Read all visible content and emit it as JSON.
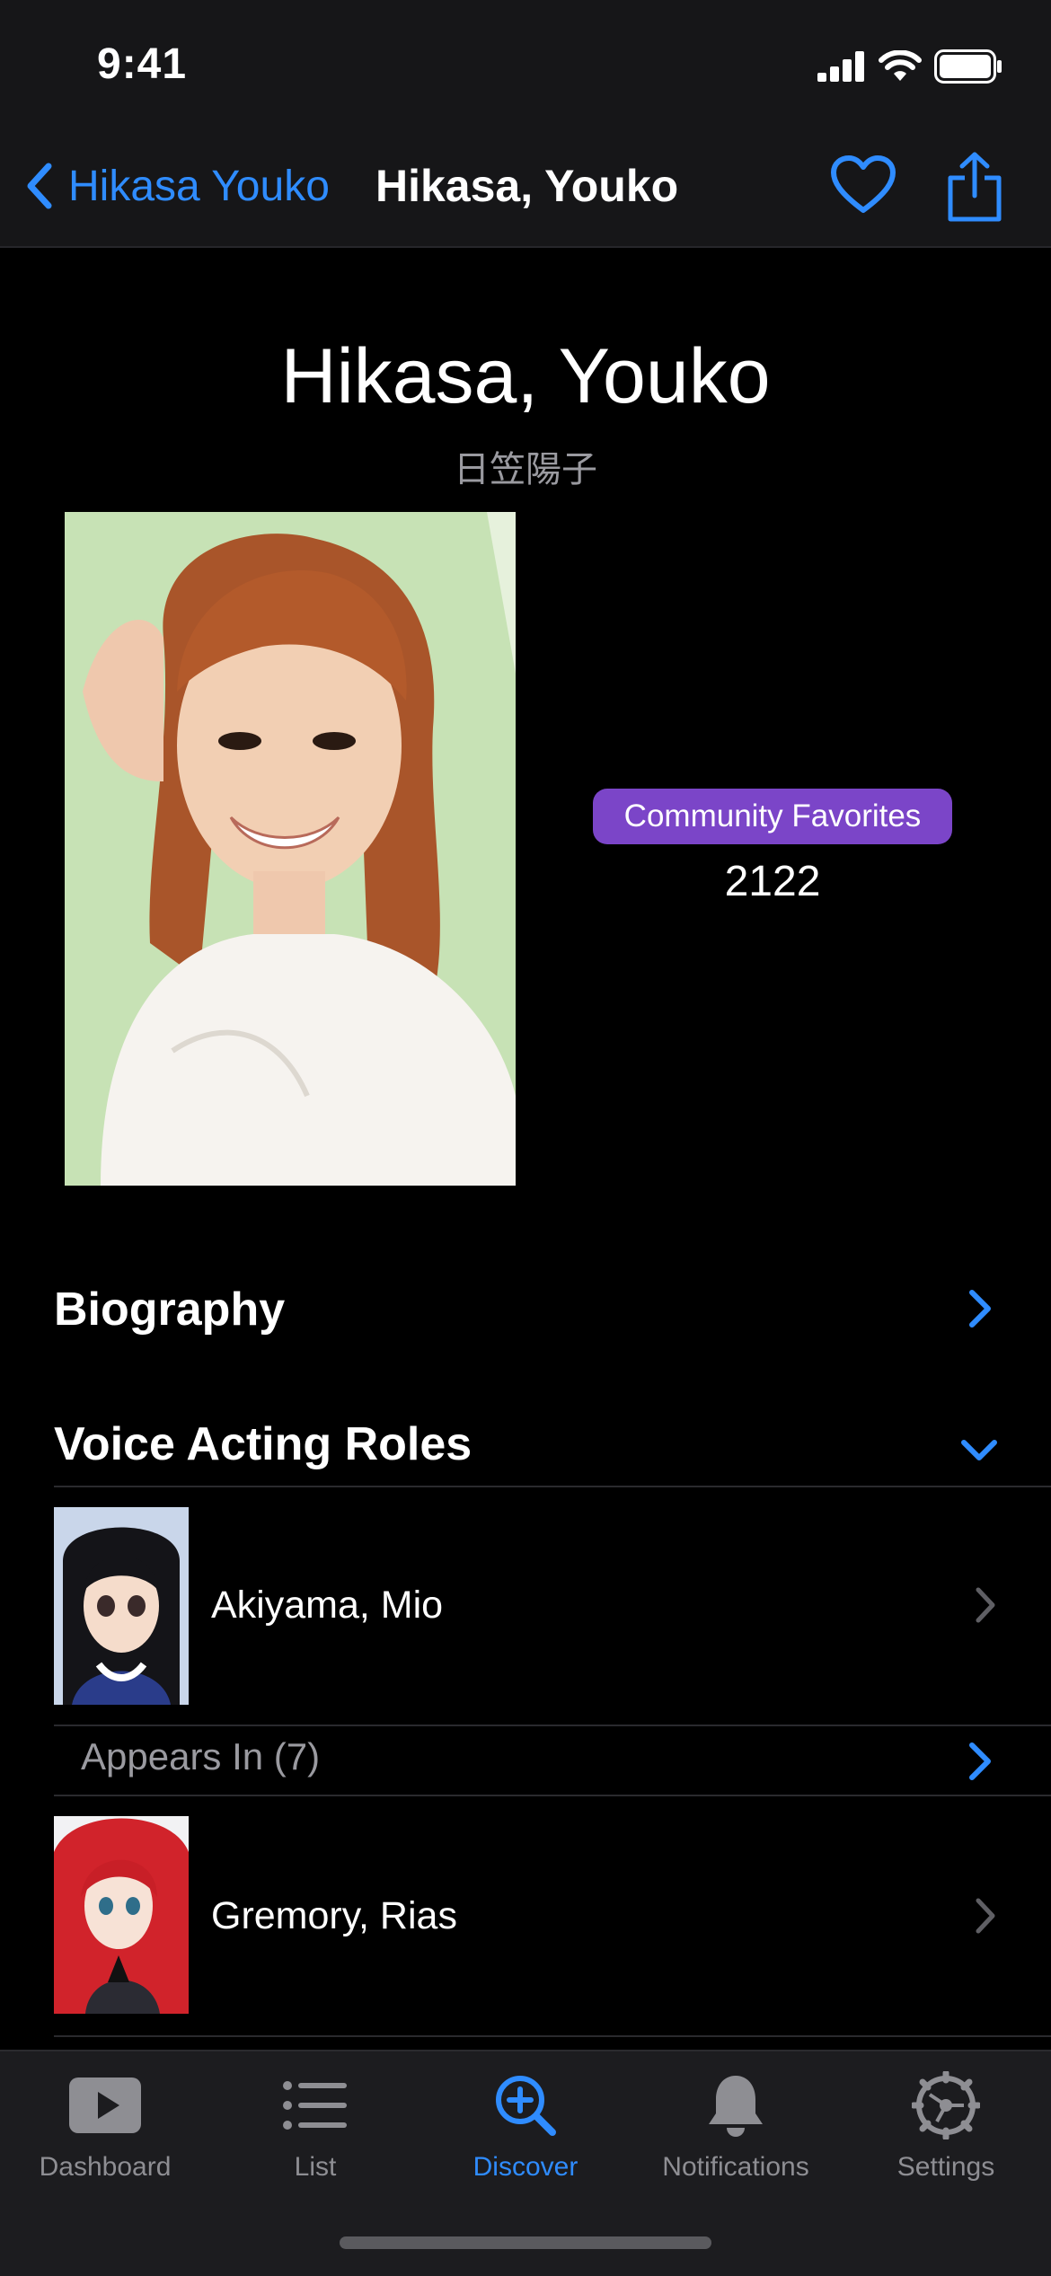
{
  "status_bar": {
    "time": "9:41"
  },
  "nav": {
    "back_label": "Hikasa Youko",
    "title": "Hikasa, Youko"
  },
  "person": {
    "name": "Hikasa, Youko",
    "native_name": "日笠陽子",
    "favorites_label": "Community Favorites",
    "favorites_count": "2122"
  },
  "sections": {
    "biography": "Biography",
    "voice_roles": "Voice Acting Roles"
  },
  "roles": [
    {
      "name": "Akiyama, Mio",
      "appears_in": "Appears In (7)"
    },
    {
      "name": "Gremory, Rias"
    }
  ],
  "tabs": [
    {
      "label": "Dashboard",
      "icon": "play-icon"
    },
    {
      "label": "List",
      "icon": "list-icon"
    },
    {
      "label": "Discover",
      "icon": "discover-icon",
      "active": true
    },
    {
      "label": "Notifications",
      "icon": "bell-icon"
    },
    {
      "label": "Settings",
      "icon": "gear-icon"
    }
  ],
  "colors": {
    "accent": "#2f8cff",
    "favorites_badge": "#7b45c8",
    "background": "#000000"
  }
}
